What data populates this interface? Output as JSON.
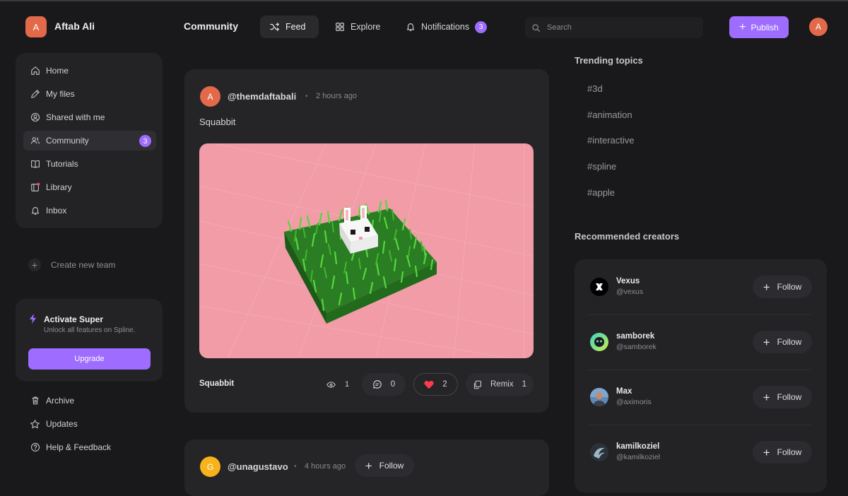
{
  "header": {
    "user_initial": "A",
    "user_name": "Aftab Ali",
    "page_title": "Community",
    "tabs": [
      {
        "label": "Feed",
        "icon": "shuffle-icon"
      },
      {
        "label": "Explore",
        "icon": "grid-icon"
      },
      {
        "label": "Notifications",
        "icon": "bell-icon",
        "badge": "3"
      }
    ],
    "search_placeholder": "Search",
    "publish_label": "Publish",
    "profile_initial": "A"
  },
  "sidebar": {
    "items": [
      {
        "label": "Home",
        "icon": "home-icon"
      },
      {
        "label": "My files",
        "icon": "pencil-icon"
      },
      {
        "label": "Shared with me",
        "icon": "user-circle-icon"
      },
      {
        "label": "Community",
        "icon": "users-icon",
        "badge": "3"
      },
      {
        "label": "Tutorials",
        "icon": "book-icon"
      },
      {
        "label": "Library",
        "icon": "library-icon"
      },
      {
        "label": "Inbox",
        "icon": "bell-icon"
      }
    ],
    "create_team": "Create new team",
    "super": {
      "title": "Activate Super",
      "subtitle": "Unlock all features on Spline.",
      "button": "Upgrade"
    },
    "footer_items": [
      {
        "label": "Archive",
        "icon": "trash-icon"
      },
      {
        "label": "Updates",
        "icon": "star-icon"
      },
      {
        "label": "Help & Feedback",
        "icon": "help-icon"
      }
    ]
  },
  "feed": {
    "post1": {
      "author_initial": "A",
      "handle": "@themdaftabali",
      "time": "2 hours ago",
      "title": "Squabbit",
      "footer_title": "Squabbit",
      "views": "1",
      "comments": "0",
      "likes": "2",
      "remix_label": "Remix",
      "remix_count": "1"
    },
    "post2": {
      "author_initial": "G",
      "handle": "@unagustavo",
      "time": "4 hours ago",
      "follow_label": "Follow"
    }
  },
  "trending": {
    "title": "Trending topics",
    "topics": [
      "#3d",
      "#animation",
      "#interactive",
      "#spline",
      "#apple"
    ]
  },
  "recommended": {
    "title": "Recommended creators",
    "creators": [
      {
        "name": "Vexus",
        "handle": "@vexus",
        "follow": "Follow"
      },
      {
        "name": "samborek",
        "handle": "@samborek",
        "follow": "Follow"
      },
      {
        "name": "Max",
        "handle": "@aximoris",
        "follow": "Follow"
      },
      {
        "name": "kamilkoziel",
        "handle": "@kamilkoziel",
        "follow": "Follow"
      }
    ]
  },
  "colors": {
    "background": "#19191b",
    "panel": "#232326",
    "accent": "#9e6cff",
    "avatar_orange": "#e2694a",
    "preview_pink": "#f19ca7",
    "like_red": "#ff3b4e"
  }
}
